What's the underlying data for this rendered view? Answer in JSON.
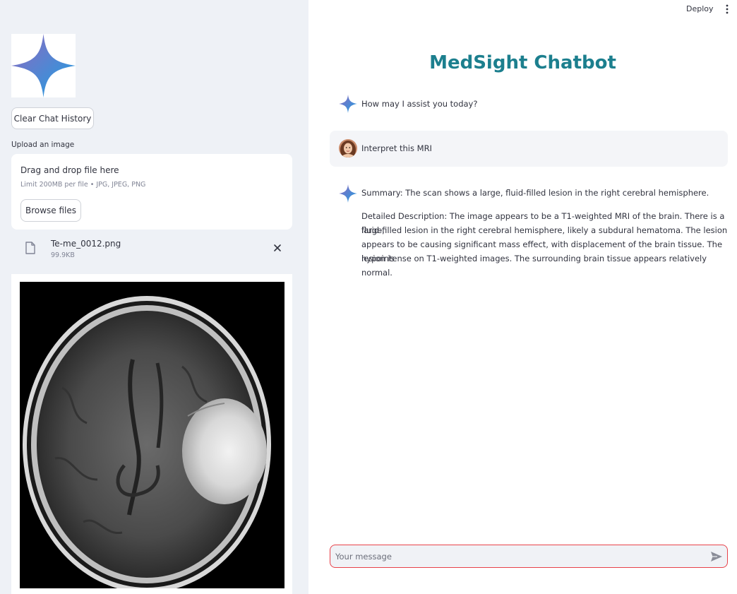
{
  "header": {
    "deploy_label": "Deploy",
    "menu_icon": "kebab-menu-icon"
  },
  "sidebar": {
    "logo_icon": "sparkle-star-icon",
    "clear_button": "Clear Chat History",
    "upload_label": "Upload an image",
    "dropzone": {
      "title": "Drag and drop file here",
      "limit": "Limit 200MB per file • JPG, JPEG, PNG",
      "browse_button": "Browse files"
    },
    "uploaded_file": {
      "name": "Te-me_0012.png",
      "size": "99.9KB"
    }
  },
  "main": {
    "title": "MedSight Chatbot",
    "messages": [
      {
        "role": "assistant",
        "text": "How may I assist you today?"
      },
      {
        "role": "user",
        "text": "Interpret this MRI"
      },
      {
        "role": "assistant",
        "summary": "Summary: The scan shows a large, fluid-filled lesion in the right cerebral hemisphere.",
        "details": [
          "Detailed Description: The image appears to be a T1-weighted MRI of the brain. There is a large,",
          "fluid-filled lesion in the right cerebral hemisphere, likely a subdural hematoma. The lesion",
          "appears to be causing significant mass effect, with displacement of the brain tissue. The lesion is",
          "hypointense on T1-weighted images. The surrounding brain tissue appears relatively normal."
        ]
      }
    ],
    "input": {
      "placeholder": "Your message",
      "value": ""
    }
  },
  "colors": {
    "accent": "#1c7f8e",
    "input_border": "#e8424a",
    "sidebar_bg": "#eef1f6"
  }
}
